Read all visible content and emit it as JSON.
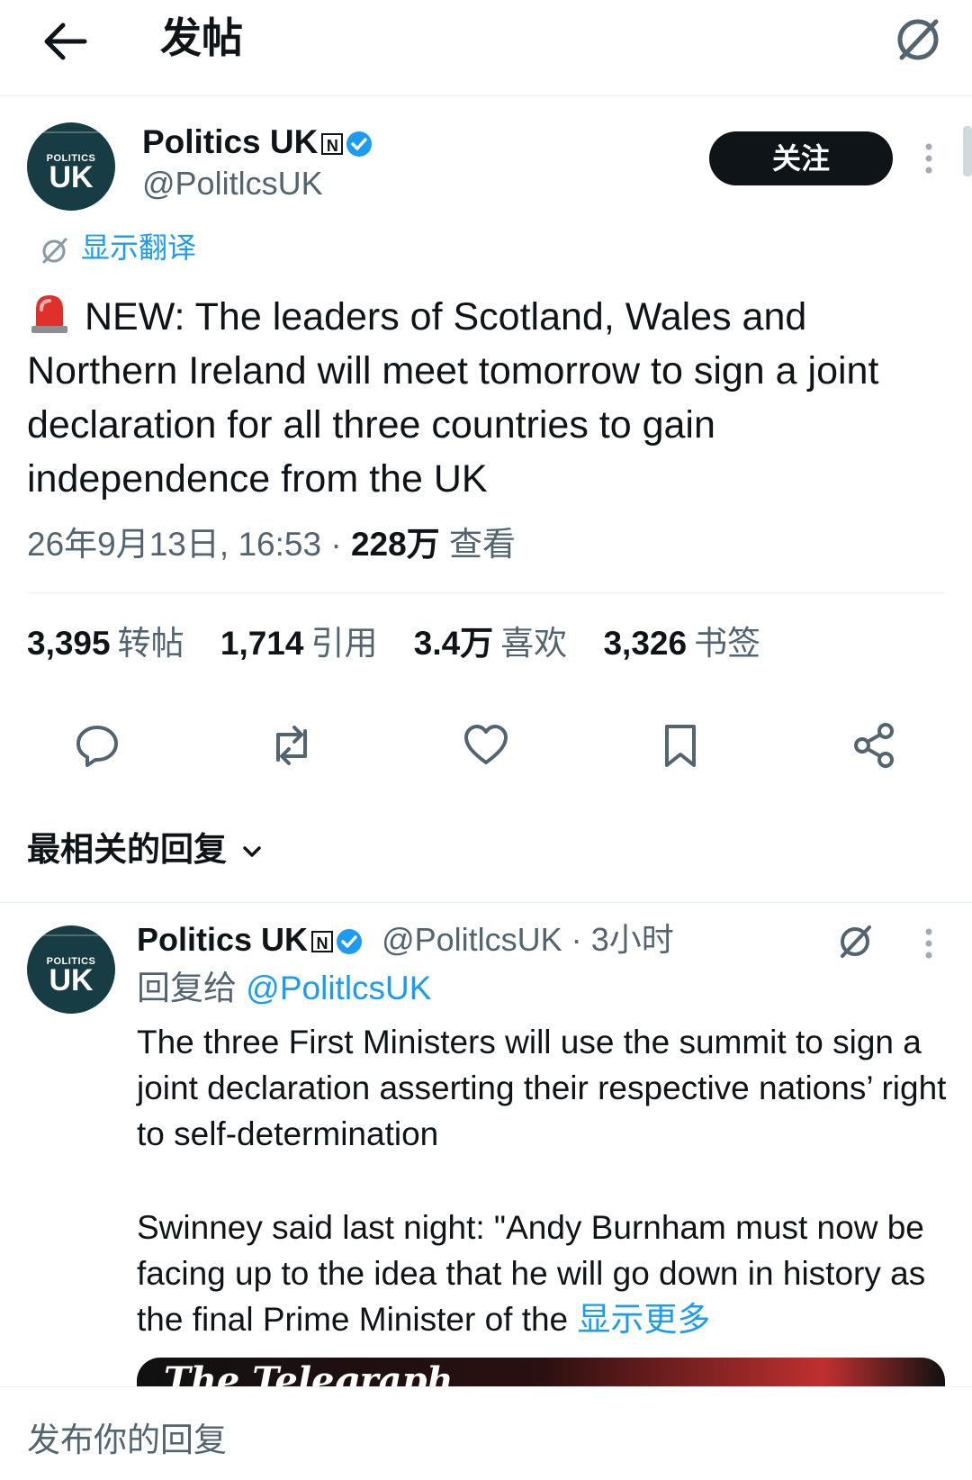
{
  "topbar": {
    "title": "发帖"
  },
  "tweet": {
    "avatar_top": "POLITICS",
    "avatar_bottom": "UK",
    "display_name": "Politics UK",
    "n_badge": "N",
    "handle": "@PolitlcsUK",
    "follow_label": "关注",
    "translate_label": "显示翻译",
    "body": "NEW: The leaders of Scotland, Wales and Northern Ireland will meet tomorrow to sign a joint declaration for all three countries to gain independence from the UK",
    "timestamp": "26年9月13日, 16:53",
    "separator": "·",
    "views_count": "228万",
    "views_label": "查看"
  },
  "stats": [
    {
      "num": "3,395",
      "label": "转帖"
    },
    {
      "num": "1,714",
      "label": "引用"
    },
    {
      "num": "3.4万",
      "label": "喜欢"
    },
    {
      "num": "3,326",
      "label": "书签"
    }
  ],
  "actions": [
    "reply-icon",
    "retweet-icon",
    "like-icon",
    "bookmark-icon",
    "share-icon"
  ],
  "replies_header": "最相关的回复",
  "reply": {
    "avatar_top": "POLITICS",
    "avatar_bottom": "UK",
    "display_name": "Politics UK",
    "n_badge": "N",
    "handle": "@PolitlcsUK",
    "dot": "·",
    "time": "3小时",
    "reply_to_prefix": "回复给",
    "reply_to_handle": "@PolitlcsUK",
    "paragraph1": "The three First Ministers will use the summit to sign a joint declaration asserting their respective nations’ right to self-determination",
    "paragraph2": "Swinney said last night: \"Andy Burnham must now be facing up to the idea that he will go down in history as the final Prime Minister of the",
    "show_more": "显示更多",
    "media_caption": "The Telegraph"
  },
  "bottom": {
    "placeholder": "发布你的回复"
  },
  "colors": {
    "accent": "#1d9bf0",
    "text": "#0f1419",
    "secondary": "#536471",
    "avatar_bg": "#173c43"
  }
}
